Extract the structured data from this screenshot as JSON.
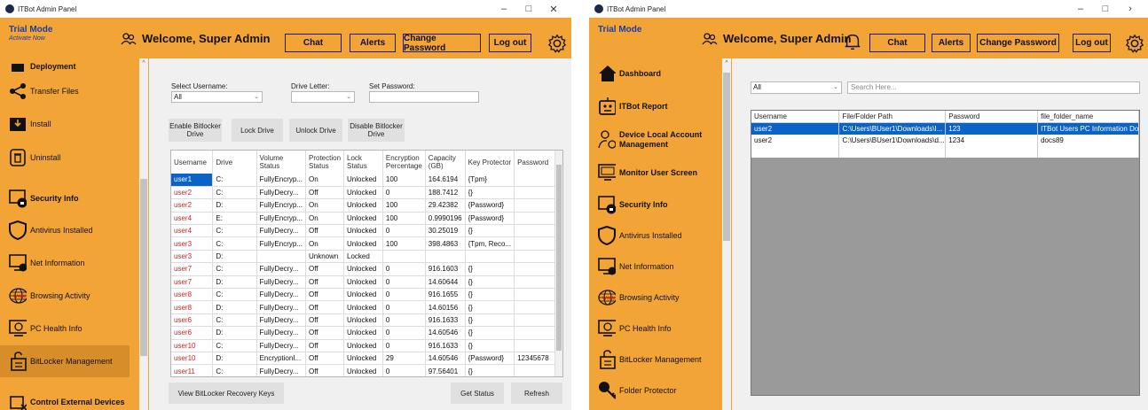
{
  "left": {
    "window_title": "ITBot Admin Panel",
    "trial_mode": "Trial Mode",
    "activate_now": "Activate Now",
    "welcome": "Welcome, Super Admin",
    "buttons": {
      "chat": "Chat",
      "alerts": "Alerts",
      "change_password": "Change Password",
      "logout": "Log out"
    },
    "sidebar": [
      {
        "label": "Deployment",
        "bold": true
      },
      {
        "label": "Transfer Files"
      },
      {
        "label": "Install"
      },
      {
        "label": "Uninstall"
      },
      {
        "label": "Security Info",
        "bold": true
      },
      {
        "label": "Antivirus Installed"
      },
      {
        "label": "Net Information"
      },
      {
        "label": "Browsing Activity"
      },
      {
        "label": "PC Health Info"
      },
      {
        "label": "BitLocker Management",
        "active": true
      },
      {
        "label": "Control External Devices",
        "bold": true
      }
    ],
    "form": {
      "select_username_label": "Select Username:",
      "select_username_value": "All",
      "drive_letter_label": "Drive Letter:",
      "drive_letter_value": "",
      "set_password_label": "Set Password:",
      "set_password_value": ""
    },
    "actions": {
      "enable": "Enable Bitlocker Drive",
      "lock": "Lock Drive",
      "unlock": "Unlock Drive",
      "disable": "Disable Bitlocker Drive",
      "view_keys": "View BitLocker Recovery Keys",
      "get_status": "Get Status",
      "refresh": "Refresh"
    },
    "table": {
      "columns": [
        "Username",
        "Drive",
        "Volume Status",
        "Protection Status",
        "Lock Status",
        "Encryption Percentage",
        "Capacity (GB)",
        "Key Protector",
        "Password"
      ],
      "rows": [
        [
          "user1",
          "C:",
          "FullyEncryp...",
          "On",
          "Unlocked",
          "100",
          "164.6194",
          "{Tpm}",
          ""
        ],
        [
          "user2",
          "C:",
          "FullyDecry...",
          "Off",
          "Unlocked",
          "0",
          "188.7412",
          "{}",
          ""
        ],
        [
          "user2",
          "D:",
          "FullyEncryp...",
          "On",
          "Unlocked",
          "100",
          "29.42382",
          "{Password}",
          ""
        ],
        [
          "user4",
          "E:",
          "FullyEncryp...",
          "On",
          "Unlocked",
          "100",
          "0.9990196",
          "{Password}",
          ""
        ],
        [
          "user4",
          "C:",
          "FullyDecry...",
          "Off",
          "Unlocked",
          "0",
          "30.25019",
          "{}",
          ""
        ],
        [
          "user3",
          "C:",
          "FullyEncryp...",
          "On",
          "Unlocked",
          "100",
          "398.4863",
          "{Tpm, Reco...",
          ""
        ],
        [
          "user3",
          "D:",
          "",
          "Unknown",
          "Locked",
          "",
          "",
          "",
          ""
        ],
        [
          "user7",
          "C:",
          "FullyDecry...",
          "Off",
          "Unlocked",
          "0",
          "916.1603",
          "{}",
          ""
        ],
        [
          "user7",
          "D:",
          "FullyDecry...",
          "Off",
          "Unlocked",
          "0",
          "14.60644",
          "{}",
          ""
        ],
        [
          "user8",
          "C:",
          "FullyDecry...",
          "Off",
          "Unlocked",
          "0",
          "916.1655",
          "{}",
          ""
        ],
        [
          "user8",
          "D:",
          "FullyDecry...",
          "Off",
          "Unlocked",
          "0",
          "14.60156",
          "{}",
          ""
        ],
        [
          "user6",
          "C:",
          "FullyDecry...",
          "Off",
          "Unlocked",
          "0",
          "916.1633",
          "{}",
          ""
        ],
        [
          "user6",
          "D:",
          "FullyDecry...",
          "Off",
          "Unlocked",
          "0",
          "14.60546",
          "{}",
          ""
        ],
        [
          "user10",
          "C:",
          "FullyDecry...",
          "Off",
          "Unlocked",
          "0",
          "916.1633",
          "{}",
          ""
        ],
        [
          "user10",
          "D:",
          "EncryptionI...",
          "Off",
          "Unlocked",
          "29",
          "14.60546",
          "{Password}",
          "12345678"
        ],
        [
          "user11",
          "C:",
          "FullyDecry...",
          "Off",
          "Unlocked",
          "0",
          "97.56401",
          "{}",
          ""
        ]
      ]
    }
  },
  "right": {
    "window_title": "ITBot Admin Panel",
    "trial_mode": "Trial Mode",
    "welcome": "Welcome, Super Admin",
    "buttons": {
      "chat": "Chat",
      "alerts": "Alerts",
      "change_password": "Change Password",
      "logout": "Log out"
    },
    "sidebar": [
      {
        "label": "Dashboard",
        "bold": true
      },
      {
        "label": "ITBot Report",
        "bold": true
      },
      {
        "label": "Device Local Account Management",
        "bold": true
      },
      {
        "label": "Monitor User Screen",
        "bold": true
      },
      {
        "label": "Security Info",
        "bold": true
      },
      {
        "label": "Antivirus Installed"
      },
      {
        "label": "Net Information"
      },
      {
        "label": "Browsing Activity"
      },
      {
        "label": "PC Health Info"
      },
      {
        "label": "BitLocker Management"
      },
      {
        "label": "Folder Protector"
      }
    ],
    "filter_value": "All",
    "search_placeholder": "Search Here...",
    "table": {
      "columns": [
        "Username",
        "File/Folder Path",
        "Password",
        "file_folder_name"
      ],
      "rows": [
        [
          "user2",
          "C:\\Users\\BUser1\\Downloads\\I...",
          "123",
          "ITBot Users PC Information Do..."
        ],
        [
          "user2",
          "C:\\Users\\BUser1\\Downloads\\d...",
          "1234",
          "docs89"
        ]
      ]
    }
  }
}
